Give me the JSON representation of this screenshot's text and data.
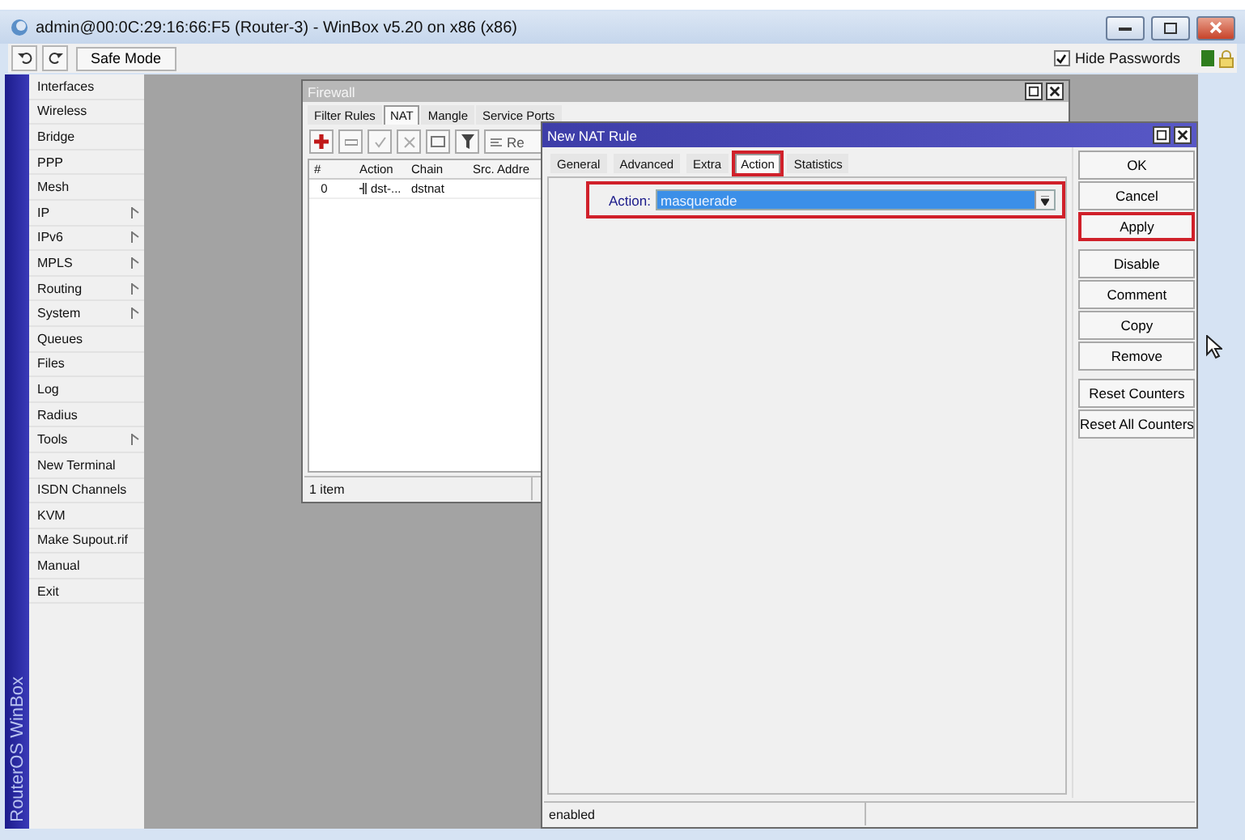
{
  "window": {
    "title": "admin@00:0C:29:16:66:F5 (Router-3) - WinBox v5.20 on x86 (x86)"
  },
  "toolbar": {
    "safe_mode": "Safe Mode",
    "hide_passwords": {
      "label": "Hide Passwords",
      "checked": true
    }
  },
  "sidebar": {
    "brand": "RouterOS WinBox",
    "items": [
      {
        "label": "Interfaces",
        "submenu": false
      },
      {
        "label": "Wireless",
        "submenu": false
      },
      {
        "label": "Bridge",
        "submenu": false
      },
      {
        "label": "PPP",
        "submenu": false
      },
      {
        "label": "Mesh",
        "submenu": false
      },
      {
        "label": "IP",
        "submenu": true
      },
      {
        "label": "IPv6",
        "submenu": true
      },
      {
        "label": "MPLS",
        "submenu": true
      },
      {
        "label": "Routing",
        "submenu": true
      },
      {
        "label": "System",
        "submenu": true
      },
      {
        "label": "Queues",
        "submenu": false
      },
      {
        "label": "Files",
        "submenu": false
      },
      {
        "label": "Log",
        "submenu": false
      },
      {
        "label": "Radius",
        "submenu": false
      },
      {
        "label": "Tools",
        "submenu": true
      },
      {
        "label": "New Terminal",
        "submenu": false
      },
      {
        "label": "ISDN Channels",
        "submenu": false
      },
      {
        "label": "KVM",
        "submenu": false
      },
      {
        "label": "Make Supout.rif",
        "submenu": false
      },
      {
        "label": "Manual",
        "submenu": false
      },
      {
        "label": "Exit",
        "submenu": false
      }
    ]
  },
  "firewall": {
    "title": "Firewall",
    "tabs": [
      {
        "label": "Filter Rules",
        "selected": false
      },
      {
        "label": "NAT",
        "selected": true
      },
      {
        "label": "Mangle",
        "selected": false
      },
      {
        "label": "Service Ports",
        "selected": false
      }
    ],
    "reset_label": "Re",
    "columns": [
      "#",
      "Action",
      "Chain",
      "Src. Addre"
    ],
    "rows": [
      {
        "number": "0",
        "action": "dst-...",
        "chain": "dstnat"
      }
    ],
    "status": "1 item"
  },
  "nat_rule": {
    "title": "New NAT Rule",
    "tabs": [
      {
        "label": "General",
        "selected": false,
        "highlighted": false
      },
      {
        "label": "Advanced",
        "selected": false,
        "highlighted": false
      },
      {
        "label": "Extra",
        "selected": false,
        "highlighted": false
      },
      {
        "label": "Action",
        "selected": true,
        "highlighted": true
      },
      {
        "label": "Statistics",
        "selected": false,
        "highlighted": false
      }
    ],
    "action": {
      "label": "Action:",
      "value": "masquerade",
      "highlighted": true
    },
    "buttons": [
      {
        "label": "OK",
        "highlighted": false
      },
      {
        "label": "Cancel",
        "highlighted": false
      },
      {
        "label": "Apply",
        "highlighted": true
      },
      {
        "label": "Disable",
        "highlighted": false
      },
      {
        "label": "Comment",
        "highlighted": false
      },
      {
        "label": "Copy",
        "highlighted": false
      },
      {
        "label": "Remove",
        "highlighted": false
      },
      {
        "label": "Reset Counters",
        "highlighted": false
      },
      {
        "label": "Reset All Counters",
        "highlighted": false
      }
    ],
    "status": "enabled"
  }
}
